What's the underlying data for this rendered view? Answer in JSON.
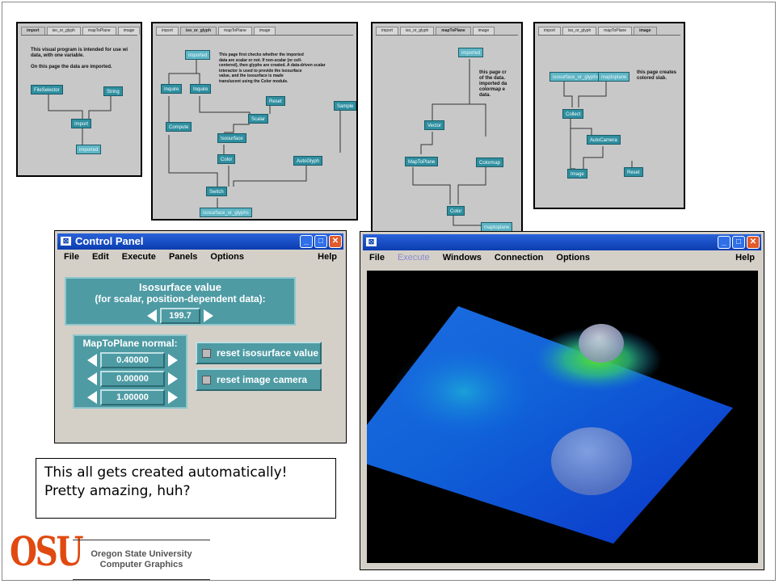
{
  "thumb1": {
    "tabs": [
      "import",
      "iso_or_glyph",
      "mapToPlane",
      "image"
    ],
    "text": [
      "This visual program is intended for use wi",
      "data, with one variable.",
      "",
      "On this page the data are imported."
    ],
    "nodes": [
      "FileSelector",
      "String",
      "Import",
      "imported"
    ]
  },
  "thumb2": {
    "tabs": [
      "import",
      "iso_or_glyph",
      "mapToPlane",
      "image"
    ],
    "text": [
      "This page first checks whether the imported",
      "data are scalar or not. If non-scalar (or cell-",
      "centered), then glyphs are created. A data-driven scalar",
      "interactor is used to provide the isosurface",
      "value, and the isosurface is made",
      "translucent using the Color module."
    ],
    "nodes": [
      "imported",
      "Inquire",
      "Inquire",
      "Reset",
      "Sample",
      "Scalar",
      "Compute",
      "Isosurface",
      "Color",
      "AutoGlyph",
      "Switch",
      "isosurface_or_glyphs"
    ]
  },
  "thumb3": {
    "tabs": [
      "import",
      "iso_or_glyph",
      "mapToPlane",
      "image"
    ],
    "text": [
      "this page cr",
      "of the data.",
      "imported da",
      "colormap e",
      "data."
    ],
    "nodes": [
      "imported",
      "Vector",
      "MapToPlane",
      "Colormap",
      "Color",
      "maptoplane"
    ]
  },
  "thumb4": {
    "tabs": [
      "import",
      "iso_or_glyph",
      "mapToPlane",
      "image"
    ],
    "text": [
      "this page creates",
      "colored slab."
    ],
    "nodes": [
      "isosurface_or_glyphs",
      "maptoplane",
      "Collect",
      "AutoCamera",
      "Image",
      "Reset"
    ]
  },
  "control_panel": {
    "title": "Control Panel",
    "menu": [
      "File",
      "Edit",
      "Execute",
      "Panels",
      "Options"
    ],
    "help": "Help",
    "iso_label_1": "Isosurface value",
    "iso_label_2": "(for scalar, position-dependent data):",
    "iso_value": "199.7",
    "normal_label": "MapToPlane normal:",
    "normal_values": [
      "0.40000",
      "0.00000",
      "1.00000"
    ],
    "reset_iso": "reset isosurface value",
    "reset_camera": "reset image camera"
  },
  "image_window": {
    "menu": [
      "File",
      "Execute",
      "Windows",
      "Connection",
      "Options"
    ],
    "help": "Help"
  },
  "caption": {
    "line1": "This all gets created automatically!",
    "line2": "Pretty amazing, huh?"
  },
  "footer": {
    "logo": "OSU",
    "line1": "Oregon State University",
    "line2": "Computer Graphics"
  },
  "colors": {
    "panel": "#4e9ba4",
    "titlebar": "#0a3db0",
    "logo": "#e04a10"
  }
}
